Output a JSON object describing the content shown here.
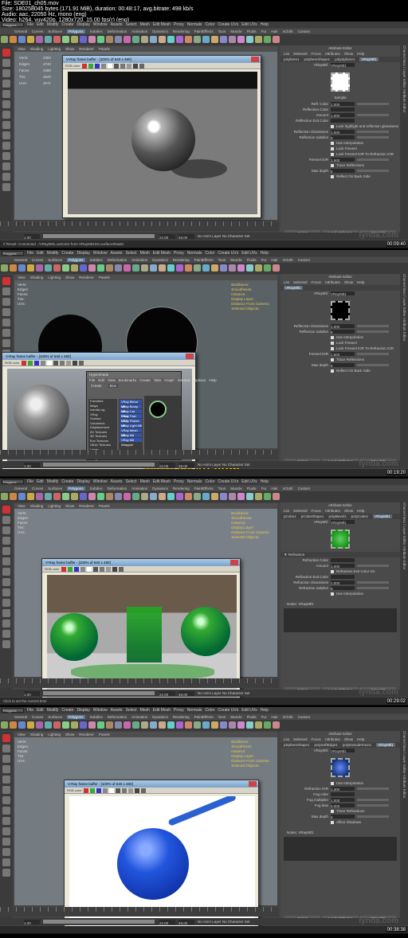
{
  "header": {
    "line1": "File: SDE01_ch05.mov",
    "line2": "Size: 180258045 bytes (171.91 MiB), duration: 00:48:17, avg.bitrate: 498 kb/s",
    "line3": "Audio: aac, 22050 Hz, mono (eng)",
    "line4": "Video: h264, yuv420p, 1280x720, 15.00 fps(r) (eng)"
  },
  "maya": {
    "menus": [
      "File",
      "Edit",
      "Modify",
      "Create",
      "Display",
      "Window",
      "Assets",
      "Select",
      "Mesh",
      "Edit Mesh",
      "Proxy",
      "Normals",
      "Color",
      "Create UVs",
      "Edit UVs",
      "Help"
    ],
    "mode_dropdown": "Polygons",
    "shelf_tabs": [
      "General",
      "Curves",
      "Surfaces",
      "Polygons",
      "Subdivs",
      "Deformation",
      "Animation",
      "Dynamics",
      "Rendering",
      "PaintEffects",
      "Toon",
      "Muscle",
      "Fluids",
      "Fur",
      "Hair",
      "nCloth",
      "Custom"
    ],
    "active_shelf_tab": "Polygons",
    "viewport_menus": [
      "View",
      "Shading",
      "Lighting",
      "Show",
      "Renderer",
      "Panels"
    ],
    "hud_labels": [
      "Verts:",
      "Edges:",
      "Faces:",
      "Tris:",
      "UVs:"
    ],
    "hud_right_labels": [
      "Backfaces:",
      "Smoothness:",
      "Instance:",
      "Display Layer:",
      "Distance From Camera:",
      "Selected Objects:"
    ],
    "attr_editor_title": "Attribute Editor",
    "attr_menu": [
      "List",
      "Selected",
      "Focus",
      "Attributes",
      "Show",
      "Help"
    ],
    "attr_buttons": [
      "Select",
      "Load Attributes",
      "Copy Tab"
    ],
    "side_tabs": "Channel Box / Layer Editor   Attribute Editor",
    "range_start": "1.00",
    "range_end": "24.00",
    "range_end2": "48.00",
    "anim_layer": "No Anim Layer",
    "char_set": "No Character Set",
    "watermark": "lynda.com"
  },
  "panels": [
    {
      "timestamp": "00:09:40",
      "hud": [
        [
          "Verts:",
          "2362",
          "2362",
          "0"
        ],
        [
          "Edges:",
          "4740",
          "4740",
          "0"
        ],
        [
          "Faces:",
          "2380",
          "2380",
          "0"
        ],
        [
          "Tris:",
          "4640",
          "4640",
          "0"
        ],
        [
          "UVs:",
          "2671",
          "2671",
          "0"
        ]
      ],
      "vfb_title": "V-Ray frame buffer - [100% of 640 x 480]",
      "vfb_channel": "RGB color",
      "attr_tabs": [
        "pSphere1",
        "pSphereShape1",
        "polySphere1",
        "VRayMtl1"
      ],
      "attr_selected_tab": "VRayMtl1",
      "material_field_label": "VRayMtl:",
      "material_name": "VRayMtl1",
      "focus_btn": "Focus",
      "presets_btn": "Presets*",
      "sample_label": "Sample",
      "attr_rows": [
        {
          "label": "Refl. Color",
          "value": "1.000"
        },
        {
          "label": "Reflection Color",
          "value": ""
        },
        {
          "label": "Amount",
          "value": "1.000"
        },
        {
          "label": "Reflection Exit Color",
          "value": ""
        },
        {
          "label": "Lock highlight and reflection glossiness",
          "value": "",
          "check": true
        },
        {
          "label": "Reflection Glossiness",
          "value": "1.000"
        },
        {
          "label": "Reflection subdivs",
          "value": "8"
        },
        {
          "label": "Use Interpolation",
          "value": "",
          "check": true
        },
        {
          "label": "Lock Fresnel",
          "value": "",
          "check": true
        },
        {
          "label": "Lock Fresnel IOR To Refraction IOR",
          "value": "",
          "check": true
        },
        {
          "label": "Fresnel IOR",
          "value": "1.600"
        },
        {
          "label": "Trace Reflections",
          "value": "",
          "check": true
        },
        {
          "label": "Max depth",
          "value": "5"
        },
        {
          "label": "Reflect On Back Side",
          "value": "",
          "check": true
        }
      ],
      "cmd_text": "// Result: Connected ../VRayMtl1.outColor from VRayMtl1SG.surfaceShader"
    },
    {
      "timestamp": "00:19:20",
      "vfb_title": "V-Ray frame buffer - [100% of 640 x 480]",
      "hypershade_title": "Hypershade",
      "hypershade_menus": [
        "File",
        "Edit",
        "View",
        "Bookmarks",
        "Create",
        "Tabs",
        "Graph",
        "Window",
        "Options",
        "Help"
      ],
      "hypershade_tabs": [
        "Create",
        "Bins"
      ],
      "hypershade_list": [
        "Favorites",
        "Maya",
        "mental ray",
        "VRay",
        "Surface",
        "Volumetric",
        "Displacement",
        "2D Textures",
        "3D Textures",
        "Env Textures",
        "Other Textures",
        "Lights",
        "Utilities",
        "Image Planes",
        "Glow"
      ],
      "hypershade_mats": [
        "VRay Blend Mtl",
        "VRay Bump Mtl",
        "VRay Car Paint",
        "VRay Fast SSS",
        "VRay Flakes Mtl",
        "VRay Light Mtl",
        "VRay Mesh Mtl",
        "VRay Mtl",
        "VRay Mtl Wrapper"
      ],
      "material_name": "VRayMtl1",
      "attr_rows": [
        {
          "label": "Reflection Glossiness",
          "value": "1.000"
        },
        {
          "label": "Reflection subdivs",
          "value": "8"
        },
        {
          "label": "Use Interpolation",
          "value": "",
          "check": true
        },
        {
          "label": "Lock Fresnel",
          "value": "",
          "check": true
        },
        {
          "label": "Lock Fresnel IOR To Refraction IOR",
          "value": "",
          "check": true
        },
        {
          "label": "Fresnel IOR",
          "value": "1.600"
        },
        {
          "label": "Trace Reflections",
          "value": "",
          "check": true
        },
        {
          "label": "Max depth",
          "value": "5"
        },
        {
          "label": "Reflect On Back Side",
          "value": "",
          "check": true
        }
      ],
      "watermark_site": "www.cg-ku.com"
    },
    {
      "timestamp": "00:29:02",
      "vfb_title": "V-Ray frame buffer - [100% of 640 x 480]",
      "attr_tabs": [
        "pCube1",
        "pCubeShape1",
        "polyBevel1",
        "polyCube1",
        "VRayMtl1"
      ],
      "material_name": "VRayMtl1",
      "section": "Refraction",
      "attr_rows": [
        {
          "label": "Refraction Color",
          "value": ""
        },
        {
          "label": "Amount",
          "value": "1.000"
        },
        {
          "label": "Refraction Exit Color On",
          "value": "",
          "check": true
        },
        {
          "label": "Refraction Exit Color",
          "value": ""
        },
        {
          "label": "Refraction Glossiness",
          "value": "1.000"
        },
        {
          "label": "Refraction subdivs",
          "value": "8"
        },
        {
          "label": "Use Interpolation",
          "value": "",
          "check": true
        }
      ],
      "notes_label": "Notes: VRayMtl1",
      "cmd_text": "Click to set the current time"
    },
    {
      "timestamp": "00:38:38",
      "vfb_title": "V-Ray frame buffer - [100% of 640 x 480]",
      "attr_tabs": [
        "pSphereShape1",
        "polySoftEdge1",
        "polyExtrudeFace1",
        "VRayMtl1"
      ],
      "material_name": "VRayMtl1",
      "attr_rows": [
        {
          "label": "Use Interpolation",
          "value": "",
          "check": true
        },
        {
          "label": "Refraction IOR",
          "value": "1.300"
        },
        {
          "label": "Fog color",
          "value": ""
        },
        {
          "label": "Fog multiplier",
          "value": "1.000"
        },
        {
          "label": "Fog bias",
          "value": "0.000"
        },
        {
          "label": "Trace Refractions",
          "value": "",
          "check": true
        },
        {
          "label": "Max depth",
          "value": "5"
        },
        {
          "label": "Affect Shadows",
          "value": "",
          "check": true
        }
      ],
      "notes_label": "Notes: VRayMtl1"
    }
  ]
}
